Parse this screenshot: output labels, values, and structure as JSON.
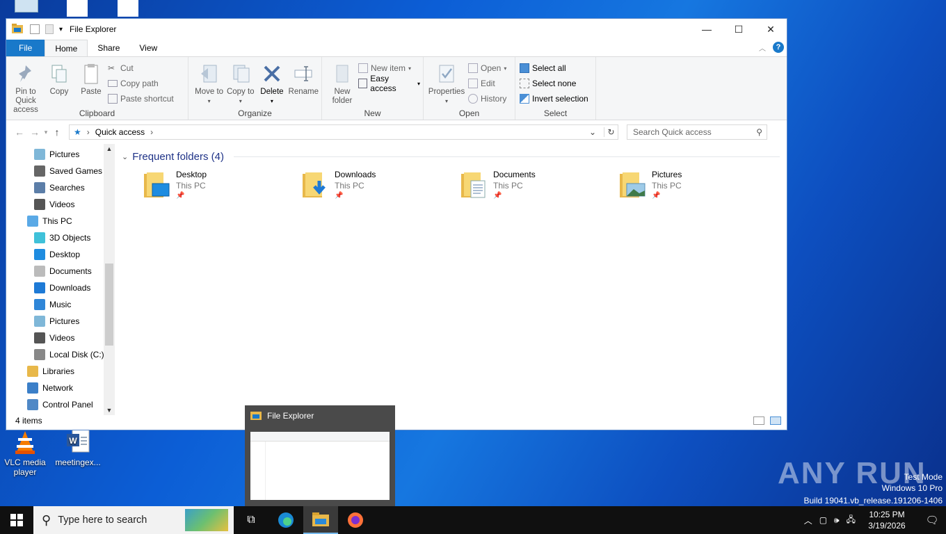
{
  "desktop": {
    "icons": [
      {
        "label": "VLC media player"
      },
      {
        "label": "meetingex..."
      }
    ],
    "watermark": {
      "line1": "Test Mode",
      "line2": "Windows 10 Pro",
      "line3": "Build 19041.vb_release.191206-1406"
    },
    "brand": "ANY RUN"
  },
  "window": {
    "title": "File Explorer",
    "tabs": {
      "file": "File",
      "home": "Home",
      "share": "Share",
      "view": "View"
    },
    "ribbon": {
      "clipboard": {
        "name": "Clipboard",
        "pin": "Pin to Quick access",
        "copy": "Copy",
        "paste": "Paste",
        "cut": "Cut",
        "copy_path": "Copy path",
        "paste_shortcut": "Paste shortcut"
      },
      "organize": {
        "name": "Organize",
        "move_to": "Move to",
        "copy_to": "Copy to",
        "delete": "Delete",
        "rename": "Rename"
      },
      "new": {
        "name": "New",
        "new_folder": "New folder",
        "new_item": "New item",
        "easy_access": "Easy access"
      },
      "open": {
        "name": "Open",
        "properties": "Properties",
        "open": "Open",
        "edit": "Edit",
        "history": "History"
      },
      "select": {
        "name": "Select",
        "select_all": "Select all",
        "select_none": "Select none",
        "invert": "Invert selection"
      }
    },
    "address": {
      "crumb": "Quick access",
      "search_placeholder": "Search Quick access"
    },
    "nav": [
      {
        "label": "Pictures",
        "icon": "pictures-icon"
      },
      {
        "label": "Saved Games",
        "icon": "saved-games-icon"
      },
      {
        "label": "Searches",
        "icon": "searches-icon"
      },
      {
        "label": "Videos",
        "icon": "videos-icon"
      },
      {
        "label": "This PC",
        "icon": "this-pc-icon"
      },
      {
        "label": "3D Objects",
        "icon": "3d-objects-icon"
      },
      {
        "label": "Desktop",
        "icon": "desktop-icon"
      },
      {
        "label": "Documents",
        "icon": "documents-icon"
      },
      {
        "label": "Downloads",
        "icon": "downloads-icon"
      },
      {
        "label": "Music",
        "icon": "music-icon"
      },
      {
        "label": "Pictures",
        "icon": "pictures-icon"
      },
      {
        "label": "Videos",
        "icon": "videos-icon"
      },
      {
        "label": "Local Disk (C:)",
        "icon": "local-disk-icon"
      },
      {
        "label": "Libraries",
        "icon": "libraries-icon"
      },
      {
        "label": "Network",
        "icon": "network-icon"
      },
      {
        "label": "Control Panel",
        "icon": "control-panel-icon"
      }
    ],
    "section_title": "Frequent folders (4)",
    "folders": [
      {
        "name": "Desktop",
        "location": "This PC"
      },
      {
        "name": "Downloads",
        "location": "This PC"
      },
      {
        "name": "Documents",
        "location": "This PC"
      },
      {
        "name": "Pictures",
        "location": "This PC"
      }
    ],
    "status": "4 items"
  },
  "preview": {
    "title": "File Explorer"
  },
  "taskbar": {
    "search_placeholder": "Type here to search",
    "time": "10:25 PM",
    "date": "3/19/2026"
  }
}
